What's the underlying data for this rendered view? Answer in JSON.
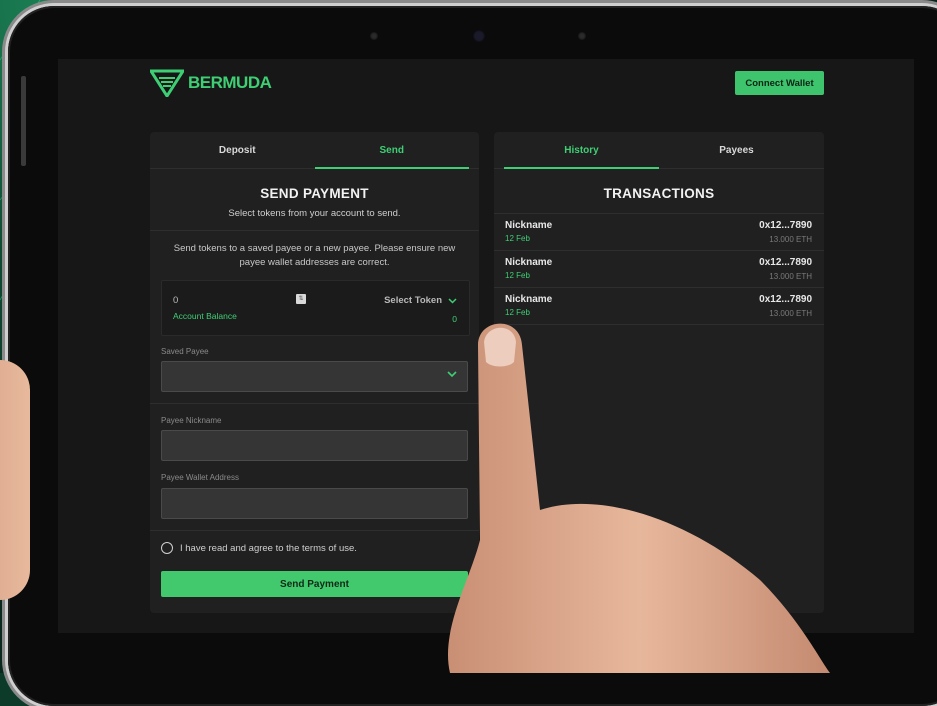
{
  "app": {
    "logo_text": "BERMUDA",
    "connect_wallet": "Connect Wallet"
  },
  "colors": {
    "accent": "#3ecf74",
    "background": "#171717",
    "panel": "#202020"
  },
  "left_panel": {
    "tabs": [
      {
        "label": "Deposit",
        "active": false
      },
      {
        "label": "Send",
        "active": true
      }
    ],
    "title": "SEND PAYMENT",
    "subtitle": "Select tokens from your account to send.",
    "notice": "Send tokens to a saved payee or a new payee. Please ensure new payee wallet addresses are correct.",
    "token": {
      "amount_value": "0",
      "select_label": "Select Token",
      "balance_label": "Account Balance",
      "balance_value": "0"
    },
    "saved_payee_label": "Saved Payee",
    "saved_payee_value": "",
    "payee_nickname_label": "Payee Nickname",
    "payee_nickname_value": "",
    "payee_wallet_label": "Payee Wallet Address",
    "payee_wallet_value": "",
    "terms_label": "I have read and agree to the terms of use.",
    "terms_checked": false,
    "send_button": "Send Payment"
  },
  "right_panel": {
    "tabs": [
      {
        "label": "History",
        "active": true
      },
      {
        "label": "Payees",
        "active": false
      }
    ],
    "title": "TRANSACTIONS",
    "transactions": [
      {
        "name": "Nickname",
        "date": "12 Feb",
        "address": "0x12...7890",
        "amount": "13.000 ETH"
      },
      {
        "name": "Nickname",
        "date": "12 Feb",
        "address": "0x12...7890",
        "amount": "13.000 ETH"
      },
      {
        "name": "Nickname",
        "date": "12 Feb",
        "address": "0x12...7890",
        "amount": "13.000 ETH"
      }
    ]
  },
  "icons": [
    "bermuda-logo-icon",
    "chevron-down-icon",
    "stepper-icon",
    "radio-icon"
  ]
}
